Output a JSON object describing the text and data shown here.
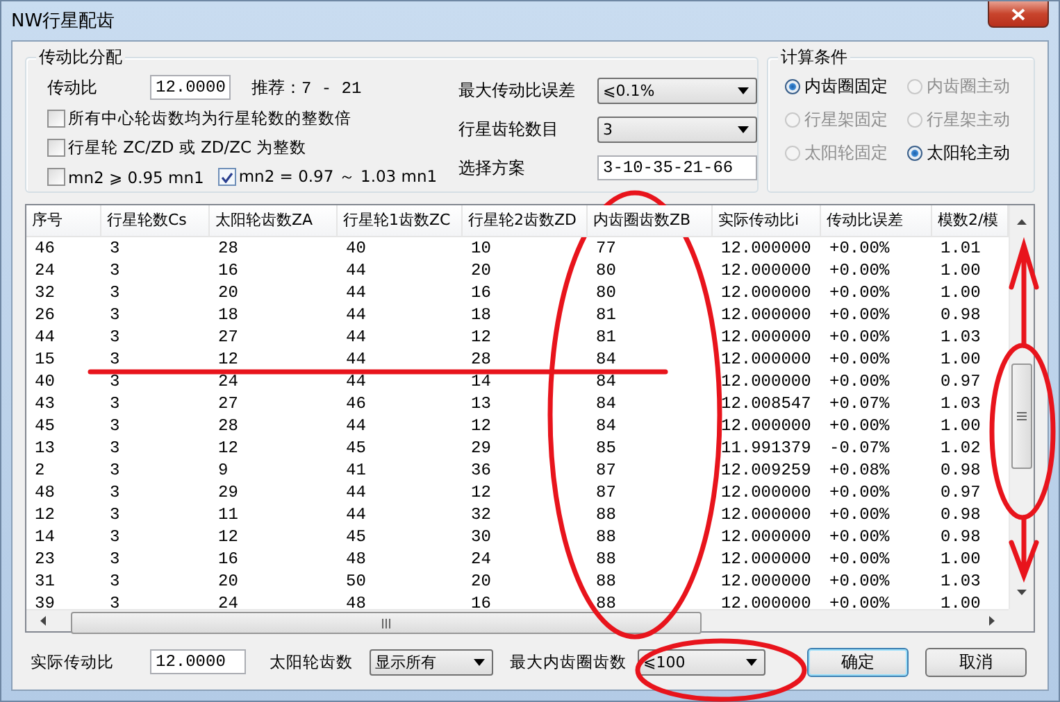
{
  "window": {
    "title": "NW行星配齿"
  },
  "ratio_group": {
    "title": "传动比分配",
    "ratio_label": "传动比",
    "ratio_value": "12.0000",
    "recommend": "推荐：7 - 21",
    "checkbox_rows": [
      [
        {
          "label": "所有中心轮齿数均为行星轮数的整数倍",
          "checked": false
        }
      ],
      [
        {
          "label": "行星轮 ZC/ZD 或 ZD/ZC 为整数",
          "checked": false
        }
      ],
      [
        {
          "label": "mn2 ⩾ 0.95 mn1",
          "checked": false
        },
        {
          "label": "mn2 = 0.97 ～ 1.03 mn1",
          "checked": true
        }
      ]
    ],
    "fields": [
      {
        "kind": "dropdown",
        "label": "最大传动比误差",
        "value": "⩽0.1%"
      },
      {
        "kind": "dropdown",
        "label": "行星齿轮数目",
        "value": "3"
      },
      {
        "kind": "text",
        "label": "选择方案",
        "value": "3-10-35-21-66"
      }
    ]
  },
  "condition_group": {
    "title": "计算条件",
    "options": [
      {
        "label": "内齿圈固定",
        "selected": true,
        "disabled": false
      },
      {
        "label": "内齿圈主动",
        "selected": false,
        "disabled": true
      },
      {
        "label": "行星架固定",
        "selected": false,
        "disabled": true
      },
      {
        "label": "行星架主动",
        "selected": false,
        "disabled": true
      },
      {
        "label": "太阳轮固定",
        "selected": false,
        "disabled": true
      },
      {
        "label": "太阳轮主动",
        "selected": true,
        "disabled": false
      }
    ]
  },
  "table": {
    "columns": [
      "序号",
      "行星轮数Cs",
      "太阳轮齿数ZA",
      "行星轮1齿数ZC",
      "行星轮2齿数ZD",
      "内齿圈齿数ZB",
      "实际传动比i",
      "传动比误差",
      "模数2/模"
    ],
    "rows": [
      [
        "46",
        "3",
        "28",
        "40",
        "10",
        "77",
        "12.000000",
        "+0.00%",
        "1.01"
      ],
      [
        "24",
        "3",
        "16",
        "44",
        "20",
        "80",
        "12.000000",
        "+0.00%",
        "1.00"
      ],
      [
        "32",
        "3",
        "20",
        "44",
        "16",
        "80",
        "12.000000",
        "+0.00%",
        "1.00"
      ],
      [
        "26",
        "3",
        "18",
        "44",
        "18",
        "81",
        "12.000000",
        "+0.00%",
        "0.98"
      ],
      [
        "44",
        "3",
        "27",
        "44",
        "12",
        "81",
        "12.000000",
        "+0.00%",
        "1.03"
      ],
      [
        "15",
        "3",
        "12",
        "44",
        "28",
        "84",
        "12.000000",
        "+0.00%",
        "1.00"
      ],
      [
        "40",
        "3",
        "24",
        "44",
        "14",
        "84",
        "12.000000",
        "+0.00%",
        "0.97"
      ],
      [
        "43",
        "3",
        "27",
        "46",
        "13",
        "84",
        "12.008547",
        "+0.07%",
        "1.03"
      ],
      [
        "45",
        "3",
        "28",
        "44",
        "12",
        "84",
        "12.000000",
        "+0.00%",
        "1.00"
      ],
      [
        "13",
        "3",
        "12",
        "45",
        "29",
        "85",
        "11.991379",
        "-0.07%",
        "1.02"
      ],
      [
        "2",
        "3",
        "9",
        "41",
        "36",
        "87",
        "12.009259",
        "+0.08%",
        "0.98"
      ],
      [
        "48",
        "3",
        "29",
        "44",
        "12",
        "87",
        "12.000000",
        "+0.00%",
        "0.97"
      ],
      [
        "12",
        "3",
        "11",
        "44",
        "32",
        "88",
        "12.000000",
        "+0.00%",
        "0.98"
      ],
      [
        "14",
        "3",
        "12",
        "45",
        "30",
        "88",
        "12.000000",
        "+0.00%",
        "0.98"
      ],
      [
        "23",
        "3",
        "16",
        "48",
        "24",
        "88",
        "12.000000",
        "+0.00%",
        "1.00"
      ],
      [
        "31",
        "3",
        "20",
        "50",
        "20",
        "88",
        "12.000000",
        "+0.00%",
        "1.03"
      ],
      [
        "39",
        "3",
        "24",
        "48",
        "16",
        "88",
        "12.000000",
        "+0.00%",
        "1.00"
      ]
    ]
  },
  "bottom": {
    "actual_label": "实际传动比",
    "actual_value": "12.0000",
    "sun_label": "太阳轮齿数",
    "sun_value": "显示所有",
    "max_label": "最大内齿圈齿数",
    "max_value": "⩽100",
    "buttons": [
      {
        "label": "确定",
        "default": true
      },
      {
        "label": "取消",
        "default": false
      }
    ]
  }
}
